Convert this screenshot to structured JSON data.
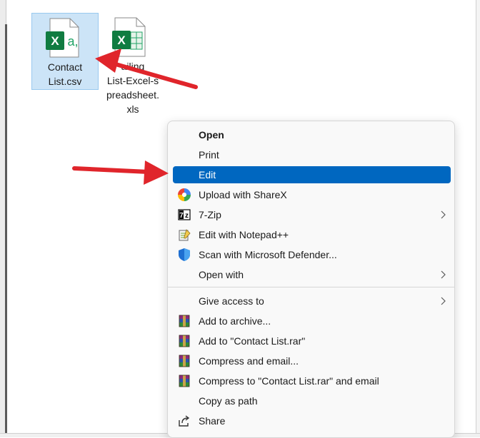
{
  "files": [
    {
      "name": "Contact\nList.csv",
      "selected": true
    },
    {
      "name": "ailing\nList-Excel-s\npreadsheet.\nxls",
      "selected": false
    }
  ],
  "menu": {
    "items": [
      {
        "label": "Open",
        "bold": true,
        "icon": ""
      },
      {
        "label": "Print",
        "icon": ""
      },
      {
        "label": "Edit",
        "highlighted": true,
        "icon": ""
      },
      {
        "label": "Upload with ShareX",
        "icon": "sharex-icon"
      },
      {
        "label": "7-Zip",
        "icon": "7zip-icon",
        "submenu": true
      },
      {
        "label": "Edit with Notepad++",
        "icon": "notepadpp-icon"
      },
      {
        "label": "Scan with Microsoft Defender...",
        "icon": "defender-shield-icon"
      },
      {
        "label": "Open with",
        "icon": "",
        "submenu": true
      },
      {
        "label": "Give access to",
        "icon": "",
        "submenu": true
      },
      {
        "label": "Add to archive...",
        "icon": "winrar-icon"
      },
      {
        "label": "Add to \"Contact List.rar\"",
        "icon": "winrar-icon"
      },
      {
        "label": "Compress and email...",
        "icon": "winrar-icon"
      },
      {
        "label": "Compress to \"Contact List.rar\" and email",
        "icon": "winrar-icon"
      },
      {
        "label": "Copy as path",
        "icon": ""
      },
      {
        "label": "Share",
        "icon": "share-icon"
      }
    ]
  },
  "colors": {
    "highlight": "#0067c0",
    "selection": "#cce4f7",
    "arrow": "#e0252b",
    "excel": "#107c41"
  }
}
